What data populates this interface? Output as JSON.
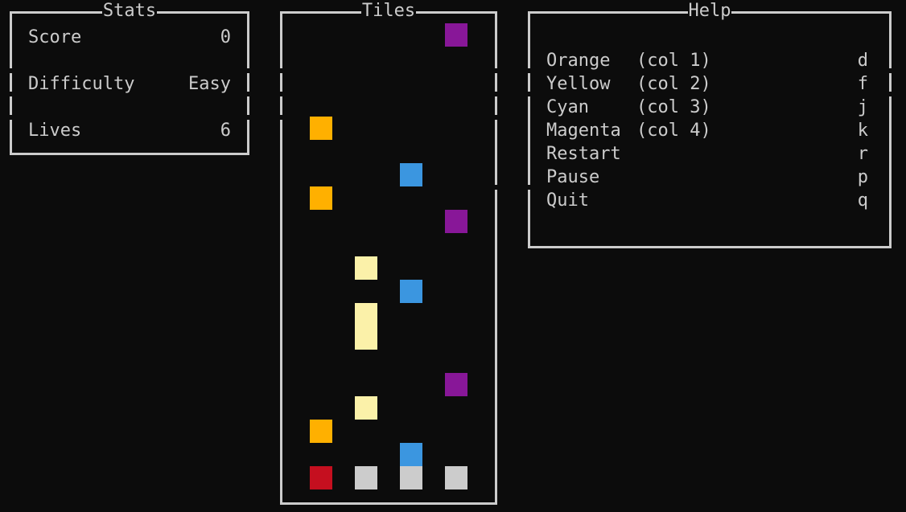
{
  "stats": {
    "title": "Stats",
    "rows": [
      {
        "label": "Score",
        "value": "0"
      },
      {
        "label": "Difficulty",
        "value": "Easy"
      },
      {
        "label": "Lives",
        "value": "6"
      }
    ]
  },
  "tiles": {
    "title": "Tiles",
    "colors": {
      "orange": "#ffb000",
      "yellow": "#fbf1a9",
      "cyan": "#3b96e0",
      "magenta": "#881798",
      "red": "#c50f1f",
      "grey": "#cccccc"
    }
  },
  "help": {
    "title": "Help",
    "items": [
      {
        "label": "Orange",
        "col": "(col 1)",
        "key": "d"
      },
      {
        "label": "Yellow",
        "col": "(col 2)",
        "key": "f"
      },
      {
        "label": "Cyan",
        "col": "(col 3)",
        "key": "j"
      },
      {
        "label": "Magenta",
        "col": "(col 4)",
        "key": "k"
      },
      {
        "label": "Restart",
        "col": "",
        "key": "r"
      },
      {
        "label": "Pause",
        "col": "",
        "key": "p"
      },
      {
        "label": "Quit",
        "col": "",
        "key": "q"
      }
    ]
  }
}
